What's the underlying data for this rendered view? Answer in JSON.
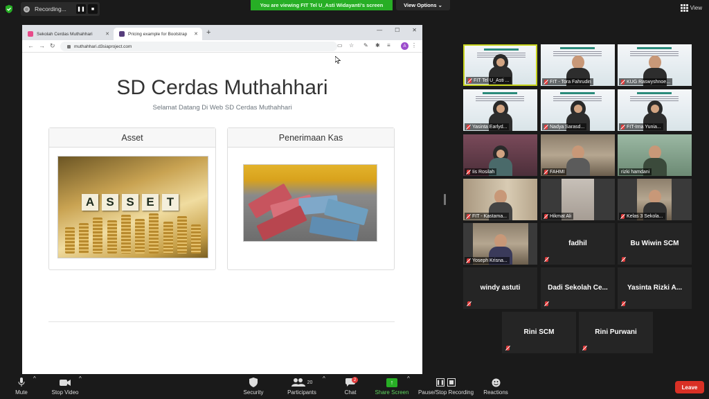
{
  "recording": {
    "label": "Recording..."
  },
  "banner": {
    "viewing": "You are viewing FIT Tel U_Asti Widayanti's screen",
    "view_options": "View Options ⌄"
  },
  "view": {
    "label": "View"
  },
  "browser": {
    "tabs": [
      {
        "label": "Sekolah Cerdas Muthahhari",
        "favicon_color": "#e84b8a"
      },
      {
        "label": "Pricing example for Bootstrap",
        "favicon_color": "#563d7c"
      }
    ],
    "url": "muthahhari.d3siaproject.com",
    "profile_initial": "A"
  },
  "page": {
    "title": "SD Cerdas Muthahhari",
    "subtitle": "Selamat Datang Di Web SD Cerdas Muthahhari",
    "cards": [
      {
        "header": "Asset",
        "image_text": [
          "A",
          "S",
          "S",
          "E",
          "T"
        ]
      },
      {
        "header": "Penerimaan Kas"
      }
    ]
  },
  "participants": [
    {
      "name": "FIT Tel U_Asti ..."
    },
    {
      "name": "FIT - Tora Fahrudin"
    },
    {
      "name": "KUG Raswyshnoe..."
    },
    {
      "name": "Yasinta Earlyd..."
    },
    {
      "name": "Nadya Sarasd..."
    },
    {
      "name": "FIT-Irna Yunia..."
    },
    {
      "name": "Iis Rosilah"
    },
    {
      "name": "FAHMI"
    },
    {
      "name": "rizki hamdani"
    },
    {
      "name": "FIT - Kastama..."
    },
    {
      "name": "Hikmat Ali"
    },
    {
      "name": "Kelas 3 Sekola..."
    },
    {
      "name": "Yoseph Krisna..."
    },
    {
      "name": "fadhil"
    },
    {
      "name": "Bu Wiwin SCM"
    },
    {
      "name": "windy astuti"
    },
    {
      "name": "Dadi Sekolah Ce..."
    },
    {
      "name": "Yasinta Rizki A..."
    },
    {
      "name": "Rini SCM"
    },
    {
      "name": "Rini Purwani"
    }
  ],
  "toolbar": {
    "mute": "Mute",
    "stop_video": "Stop Video",
    "security": "Security",
    "participants": "Participants",
    "participants_count": "20",
    "chat": "Chat",
    "chat_badge": "2",
    "share_screen": "Share Screen",
    "pause_recording": "Pause/Stop Recording",
    "reactions": "Reactions",
    "leave": "Leave"
  },
  "colors": {
    "share_green": "#27ae25",
    "leave_red": "#d93025",
    "active_speaker": "#c7d31c"
  }
}
